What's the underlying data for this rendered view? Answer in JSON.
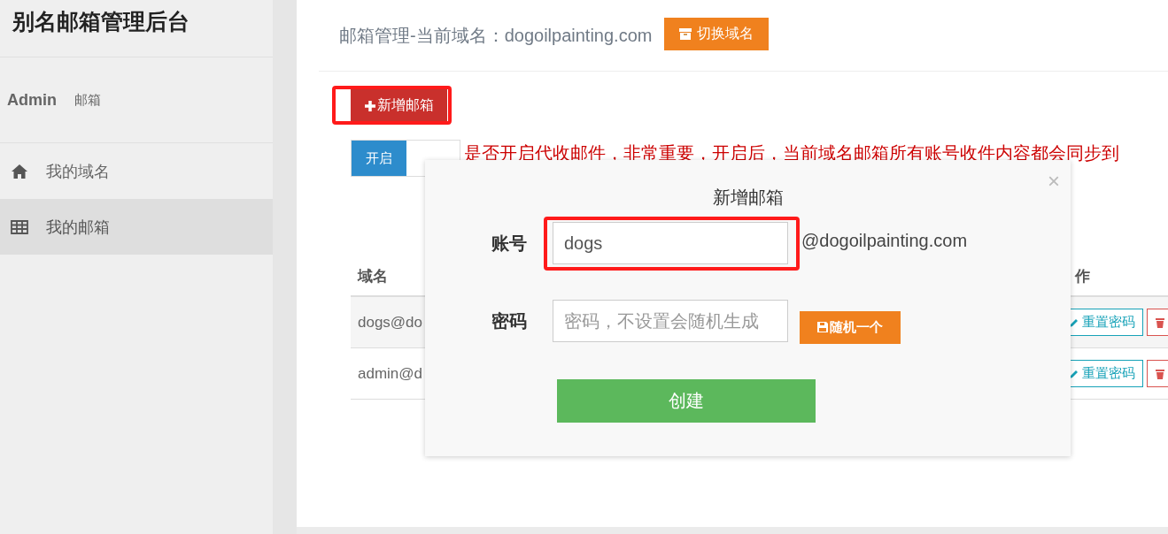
{
  "sidebar": {
    "title": "别名邮箱管理后台",
    "user": {
      "name": "Admin",
      "role": "邮箱"
    },
    "items": [
      {
        "label": "我的域名",
        "selected": false
      },
      {
        "label": "我的邮箱",
        "selected": true
      }
    ]
  },
  "header": {
    "title": "邮箱管理-当前域名：dogoilpainting.com",
    "button": "切换域名"
  },
  "add_button": {
    "label": "新增邮箱",
    "highlighted": true
  },
  "toggle": {
    "label": "开启",
    "on": true
  },
  "notice": "是否开启代收邮件，非常重要，开启后，当前域名邮箱所有账号收件内容都会同步到",
  "table": {
    "columns": [
      "域名",
      "作"
    ],
    "rows": [
      {
        "domain": "dogs@do",
        "actions": [
          "重置密码"
        ]
      },
      {
        "domain": "admin@d",
        "actions": [
          "重置密码"
        ]
      }
    ]
  },
  "modal": {
    "title": "新增邮箱",
    "close": "×",
    "fields": [
      {
        "label": "账号",
        "value": "dogs",
        "suffix": "@dogoilpainting.com",
        "highlighted": true
      },
      {
        "label": "密码",
        "placeholder": "密码，不设置会随机生成",
        "button": "随机一个"
      }
    ],
    "submit": "创建"
  }
}
